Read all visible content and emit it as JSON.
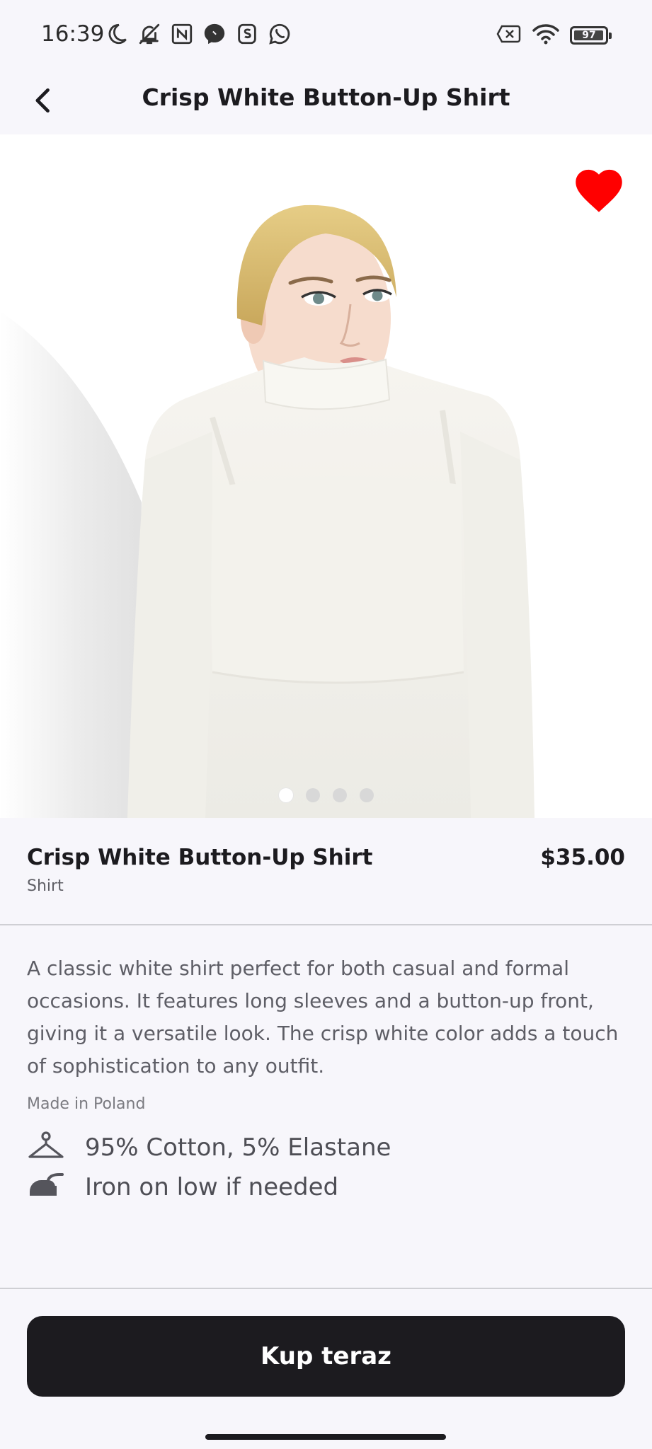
{
  "status_bar": {
    "time": "16:39",
    "battery": "97",
    "battery_level": 0.97
  },
  "app_bar": {
    "title": "Crisp White Button-Up Shirt"
  },
  "gallery": {
    "image_count": 4,
    "active_index": 0,
    "favorite": true,
    "favorite_color": "#ff0000"
  },
  "product": {
    "name": "Crisp White Button-Up Shirt",
    "category": "Shirt",
    "price": "$35.00",
    "description": "A classic white shirt perfect for both casual and formal occasions. It features long sleeves and a button-up front, giving it a versatile look. The crisp white color adds a touch of sophistication to any outfit.",
    "origin": "Made in Poland",
    "features": [
      {
        "icon": "hanger-icon",
        "text": "95% Cotton, 5% Elastane"
      },
      {
        "icon": "iron-icon",
        "text": "Iron on low if needed"
      }
    ]
  },
  "actions": {
    "buy_label": "Kup teraz"
  },
  "colors": {
    "background": "#f7f6fb",
    "primary": "#1c1b1f",
    "accent_heart": "#ff0000"
  }
}
